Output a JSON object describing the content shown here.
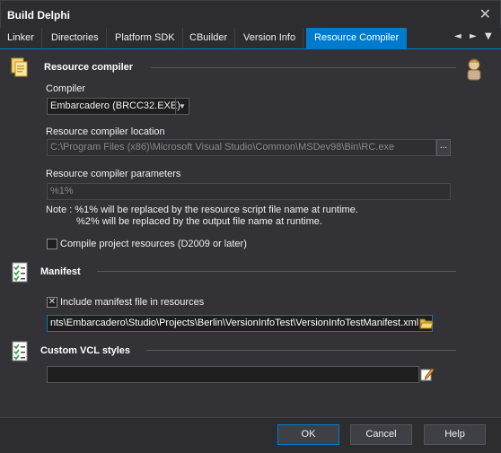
{
  "window": {
    "title": "Build Delphi",
    "close_glyph": "✕"
  },
  "tabs": [
    {
      "label": "Linker"
    },
    {
      "label": "Directories"
    },
    {
      "label": "Platform SDK"
    },
    {
      "label": "CBuilder"
    },
    {
      "label": "Version Info"
    },
    {
      "label": "Resource Compiler",
      "active": true
    }
  ],
  "tab_nav": {
    "left": "◄",
    "right": "►",
    "menu": "▼"
  },
  "resource_compiler": {
    "section_title": "Resource compiler",
    "compiler_label": "Compiler",
    "compiler_value": "Embarcadero (BRCC32.EXE)",
    "location_label": "Resource compiler location",
    "location_value": "C:\\Program Files (x86)\\Microsoft Visual Studio\\Common\\MSDev98\\Bin\\RC.exe",
    "location_browse": "...",
    "params_label": "Resource compiler parameters",
    "params_value": "%1%",
    "note_line1": "Note : %1% will be replaced by the resource script file name at runtime.",
    "note_line2": "%2% will be replaced by the output file name at runtime.",
    "compile_resources_label": "Compile project resources (D2009 or later)",
    "compile_resources_checked": false
  },
  "manifest": {
    "section_title": "Manifest",
    "include_label": "Include manifest file in resources",
    "include_checked": true,
    "include_glyph": "✕",
    "file_value": "nts\\Embarcadero\\Studio\\Projects\\Berlin\\VersionInfoTest\\VersionInfoTestManifest.xml"
  },
  "vcl_styles": {
    "section_title": "Custom VCL styles",
    "value": ""
  },
  "buttons": {
    "ok": "OK",
    "cancel": "Cancel",
    "help": "Help"
  },
  "colors": {
    "accent": "#007acc",
    "background": "#333337",
    "titlebar": "#2d2d30"
  }
}
